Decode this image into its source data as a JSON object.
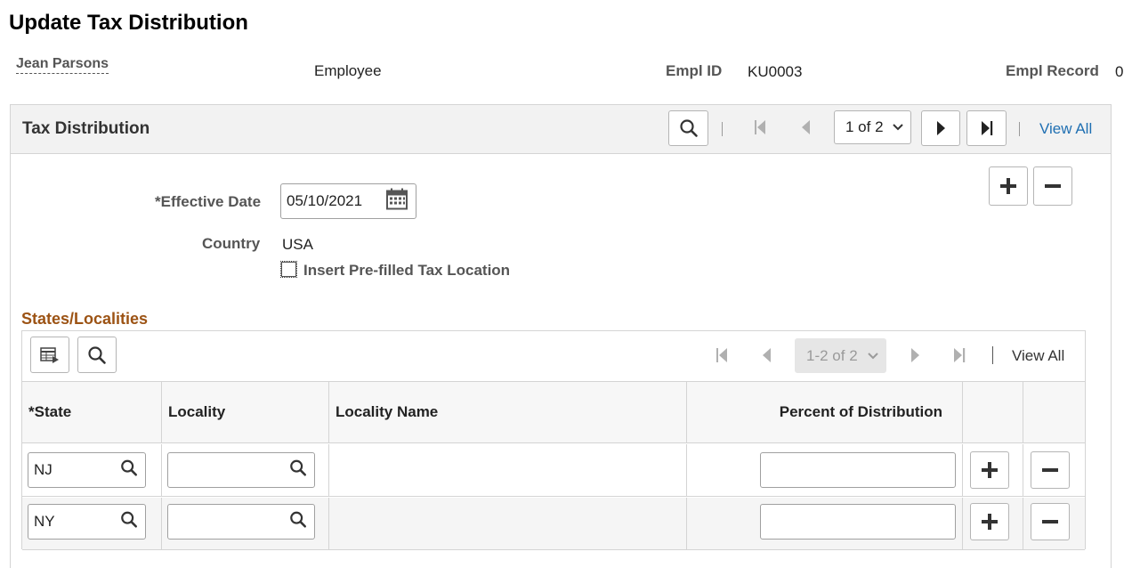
{
  "page": {
    "title": "Update Tax Distribution"
  },
  "employee": {
    "name": "Jean Parsons",
    "role": "Employee",
    "empl_id_label": "Empl ID",
    "empl_id": "KU0003",
    "empl_record_label": "Empl Record",
    "empl_record": "0"
  },
  "tax_distribution": {
    "title": "Tax Distribution",
    "pager_value": "1 of 2",
    "view_all": "View All",
    "effective_date_label": "*Effective Date",
    "effective_date": "05/10/2021",
    "country_label": "Country",
    "country": "USA",
    "insert_prefilled_label": "Insert Pre-filled Tax Location"
  },
  "states_localities": {
    "title": "States/Localities",
    "pager_value": "1-2 of 2",
    "view_all": "View All",
    "columns": {
      "state": "*State",
      "locality": "Locality",
      "locality_name": "Locality Name",
      "percent": "Percent of Distribution"
    },
    "rows": [
      {
        "state": "NJ",
        "locality": "",
        "locality_name": "",
        "percent": ""
      },
      {
        "state": "NY",
        "locality": "",
        "locality_name": "",
        "percent": ""
      }
    ]
  },
  "icons": {
    "search": "search-icon",
    "first": "first-page-icon",
    "prev": "previous-page-icon",
    "next": "next-page-icon",
    "last": "last-page-icon",
    "calendar": "calendar-icon",
    "add": "plus-icon",
    "delete": "minus-icon",
    "personalize": "grid-personalize-icon"
  },
  "colors": {
    "link": "#1f6fb2",
    "section_title": "#9c5314",
    "header_bg": "#f2f2f2"
  }
}
